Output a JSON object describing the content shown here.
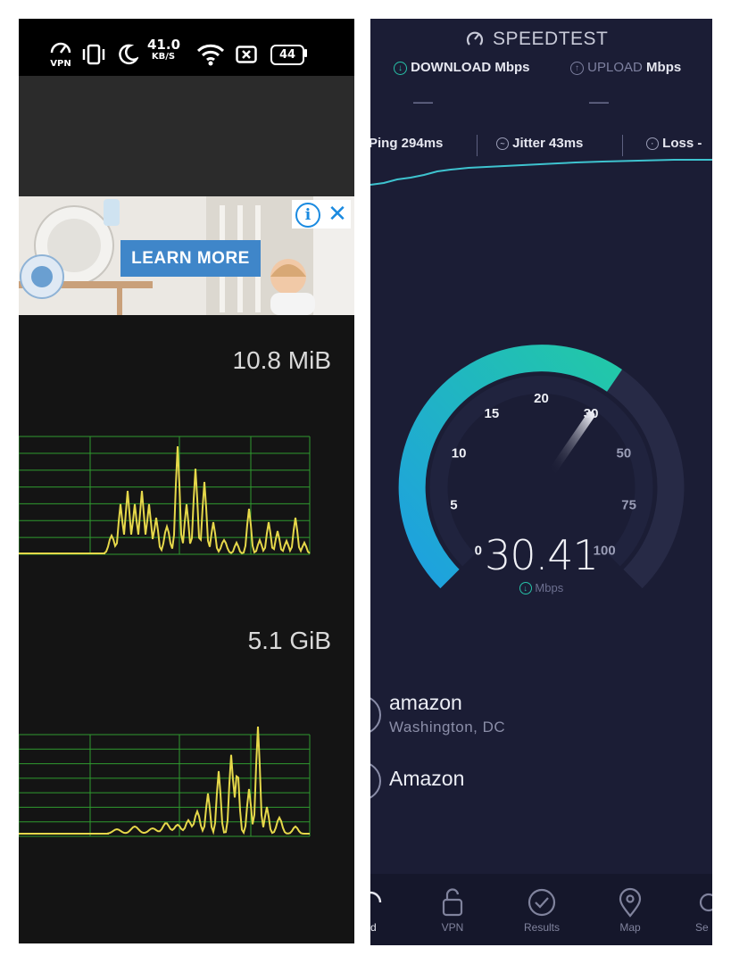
{
  "left_panel": {
    "status_bar": {
      "vpn_label": "VPN",
      "net_speed_value": "41.0",
      "net_speed_unit": "KB/S",
      "battery": "44"
    },
    "ad": {
      "button_label": "LEARN MORE",
      "info_glyph": "i",
      "close_glyph": "✕"
    },
    "graphs": [
      {
        "total": "10.8 MiB",
        "color": "#e6d84a",
        "grid_color": "#2f9a2f"
      },
      {
        "total": "5.1 GiB",
        "color": "#e6d84a",
        "grid_color": "#2f9a2f"
      }
    ]
  },
  "right_panel": {
    "app_title": "SPEEDTEST",
    "tabs": {
      "download_label": "DOWNLOAD",
      "download_unit": "Mbps",
      "upload_label": "UPLOAD",
      "upload_unit": "Mbps",
      "download_placeholder": "—",
      "upload_placeholder": "—"
    },
    "metrics": {
      "ping_label": "Ping",
      "ping_value": "294ms",
      "jitter_label": "Jitter",
      "jitter_value": "43ms",
      "loss_label": "Loss",
      "loss_value": "-"
    },
    "gauge": {
      "ticks": [
        "0",
        "5",
        "10",
        "15",
        "20",
        "30",
        "50",
        "75",
        "100"
      ],
      "value": 30.41,
      "value_text": "30.41",
      "unit": "Mbps",
      "accent_start": "#1ea0e0",
      "accent_end": "#22c8a8"
    },
    "servers": [
      {
        "name": "amazon",
        "location": "Washington, DC"
      },
      {
        "name": "Amazon",
        "location": ""
      }
    ],
    "nav": [
      {
        "label": "ed",
        "icon": "speed-icon"
      },
      {
        "label": "VPN",
        "icon": "lock-icon"
      },
      {
        "label": "Results",
        "icon": "check-circle-icon"
      },
      {
        "label": "Map",
        "icon": "map-pin-icon"
      },
      {
        "label": "Se",
        "icon": "settings-icon"
      }
    ]
  }
}
